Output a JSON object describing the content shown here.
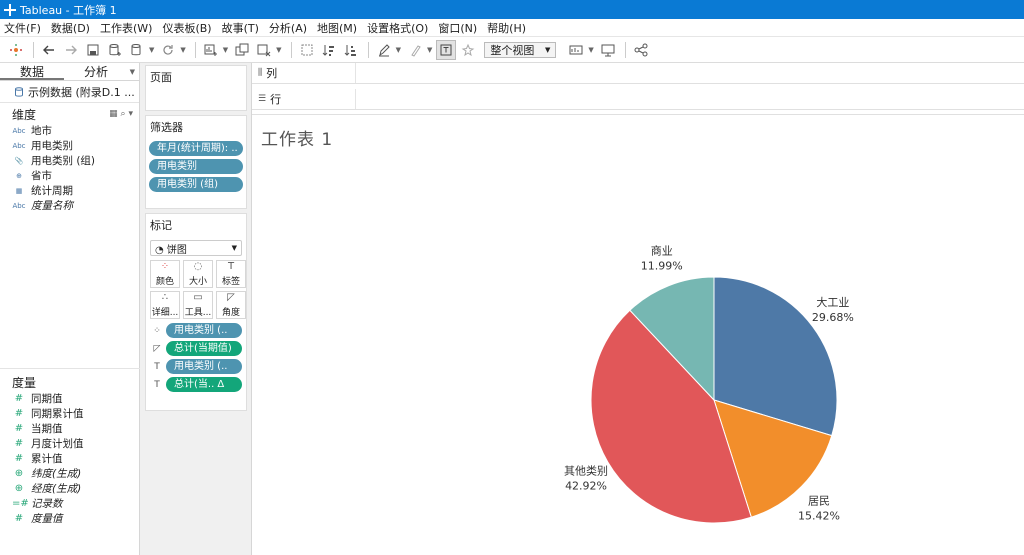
{
  "window": {
    "title": "Tableau - 工作簿 1"
  },
  "menu": [
    "文件(F)",
    "数据(D)",
    "工作表(W)",
    "仪表板(B)",
    "故事(T)",
    "分析(A)",
    "地图(M)",
    "设置格式(O)",
    "窗口(N)",
    "帮助(H)"
  ],
  "toolbar": {
    "view_label": "整个视图"
  },
  "data_pane": {
    "tab_data": "数据",
    "tab_analysis": "分析",
    "datasource": "示例数据 (附录D.1 ...",
    "dimensions_title": "维度",
    "dimensions": [
      {
        "label": "地市",
        "icon": "Abc"
      },
      {
        "label": "用电类别",
        "icon": "Abc"
      },
      {
        "label": "用电类别 (组)",
        "icon": "📎"
      },
      {
        "label": "省市",
        "icon": "⊕"
      },
      {
        "label": "统计周期",
        "icon": "▦"
      },
      {
        "label": "度量名称",
        "icon": "Abc"
      }
    ],
    "measures_title": "度量",
    "measures": [
      {
        "label": "同期值",
        "icon": "#"
      },
      {
        "label": "同期累计值",
        "icon": "#"
      },
      {
        "label": "当期值",
        "icon": "#"
      },
      {
        "label": "月度计划值",
        "icon": "#"
      },
      {
        "label": "累计值",
        "icon": "#"
      },
      {
        "label": "纬度(生成)",
        "icon": "⊕"
      },
      {
        "label": "经度(生成)",
        "icon": "⊕"
      },
      {
        "label": "记录数",
        "icon": "=#"
      },
      {
        "label": "度量值",
        "icon": "#"
      }
    ]
  },
  "cards": {
    "pages_title": "页面",
    "filters_title": "筛选器",
    "filters": [
      "年月(统计周期): ..",
      "用电类别",
      "用电类别 (组)"
    ],
    "marks_title": "标记",
    "mark_type": "饼图",
    "mark_buttons": [
      {
        "label": "颜色",
        "icon": "⁘"
      },
      {
        "label": "大小",
        "icon": "◌"
      },
      {
        "label": "标签",
        "icon": "T"
      },
      {
        "label": "详细...",
        "icon": "∴"
      },
      {
        "label": "工具...",
        "icon": "▭"
      },
      {
        "label": "角度",
        "icon": "◸"
      }
    ],
    "mark_fields": [
      {
        "label": "用电类别 (..",
        "icon": "⁘",
        "kind": "dim"
      },
      {
        "label": "总计(当期值)",
        "icon": "◸",
        "kind": "mea"
      },
      {
        "label": "用电类别 (..",
        "icon": "T",
        "kind": "dim"
      },
      {
        "label": "总计(当..     Δ",
        "icon": "T",
        "kind": "mea"
      }
    ]
  },
  "shelves": {
    "columns_label": "列",
    "rows_label": "行"
  },
  "sheet": {
    "title": "工作表 1"
  },
  "chart_data": {
    "type": "pie",
    "title": "",
    "slices": [
      {
        "name": "大工业",
        "value": 29.68,
        "label": "29.68%",
        "color": "#4e79a7"
      },
      {
        "name": "居民",
        "value": 15.42,
        "label": "15.42%",
        "color": "#f28e2b"
      },
      {
        "name": "其他类别",
        "value": 42.92,
        "label": "42.92%",
        "color": "#e15759"
      },
      {
        "name": "商业",
        "value": 11.99,
        "label": "11.99%",
        "color": "#76b7b2"
      }
    ],
    "start": "12 o'clock",
    "direction": "clockwise"
  }
}
